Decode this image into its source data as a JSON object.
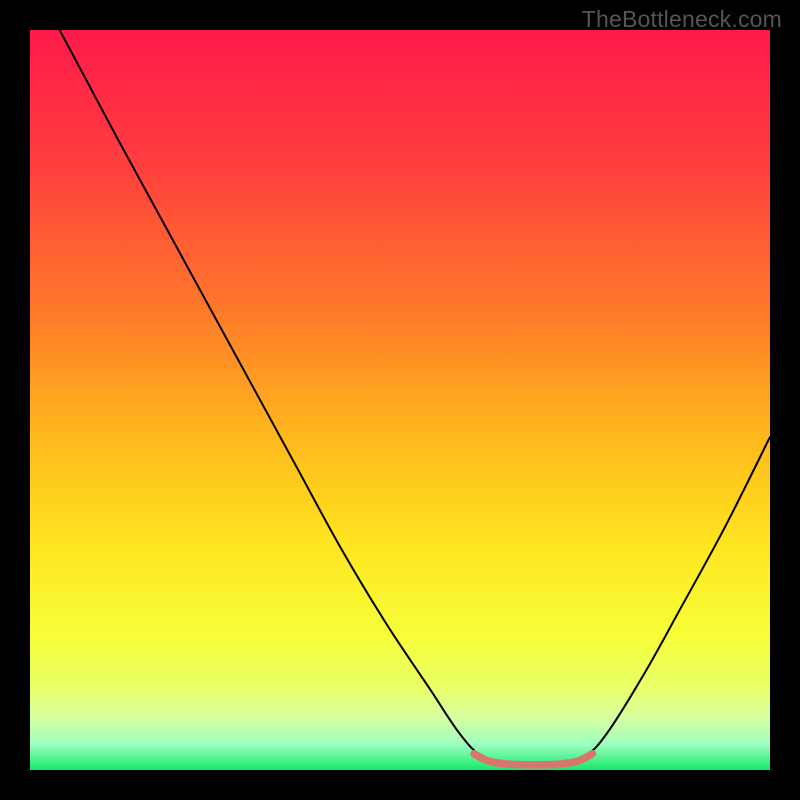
{
  "watermark": "TheBottleneck.com",
  "chart_data": {
    "type": "line",
    "title": "",
    "xlabel": "",
    "ylabel": "",
    "xlim": [
      0,
      100
    ],
    "ylim": [
      0,
      100
    ],
    "background_gradient_stops": [
      {
        "offset": 0.0,
        "color": "#ff1a4b"
      },
      {
        "offset": 0.18,
        "color": "#ff3e3e"
      },
      {
        "offset": 0.38,
        "color": "#ff7a2a"
      },
      {
        "offset": 0.55,
        "color": "#ffb81c"
      },
      {
        "offset": 0.7,
        "color": "#ffe620"
      },
      {
        "offset": 0.82,
        "color": "#f6ff3a"
      },
      {
        "offset": 0.89,
        "color": "#e9ff6a"
      },
      {
        "offset": 0.93,
        "color": "#d6ffa0"
      },
      {
        "offset": 0.965,
        "color": "#9cffc0"
      },
      {
        "offset": 1.0,
        "color": "#17e86b"
      }
    ],
    "series": [
      {
        "name": "bottleneck-curve",
        "color": "#000000",
        "width": 2.0,
        "points": [
          {
            "x": 4.0,
            "y": 100.0
          },
          {
            "x": 8.0,
            "y": 92.5
          },
          {
            "x": 12.0,
            "y": 85.0
          },
          {
            "x": 18.0,
            "y": 74.0
          },
          {
            "x": 24.0,
            "y": 63.0
          },
          {
            "x": 30.0,
            "y": 52.0
          },
          {
            "x": 36.0,
            "y": 41.0
          },
          {
            "x": 42.0,
            "y": 30.0
          },
          {
            "x": 48.0,
            "y": 20.0
          },
          {
            "x": 54.0,
            "y": 11.0
          },
          {
            "x": 58.0,
            "y": 5.0
          },
          {
            "x": 61.0,
            "y": 1.8
          },
          {
            "x": 64.0,
            "y": 0.6
          },
          {
            "x": 68.0,
            "y": 0.4
          },
          {
            "x": 72.0,
            "y": 0.6
          },
          {
            "x": 75.0,
            "y": 1.8
          },
          {
            "x": 78.0,
            "y": 5.0
          },
          {
            "x": 83.0,
            "y": 13.0
          },
          {
            "x": 88.0,
            "y": 22.0
          },
          {
            "x": 94.0,
            "y": 33.0
          },
          {
            "x": 100.0,
            "y": 45.0
          }
        ]
      },
      {
        "name": "optimal-zone-marker",
        "color": "#d9766b",
        "width": 7.5,
        "points": [
          {
            "x": 60.0,
            "y": 2.2
          },
          {
            "x": 62.0,
            "y": 1.2
          },
          {
            "x": 64.5,
            "y": 0.8
          },
          {
            "x": 68.0,
            "y": 0.7
          },
          {
            "x": 71.5,
            "y": 0.8
          },
          {
            "x": 74.0,
            "y": 1.2
          },
          {
            "x": 76.0,
            "y": 2.2
          }
        ]
      }
    ]
  }
}
